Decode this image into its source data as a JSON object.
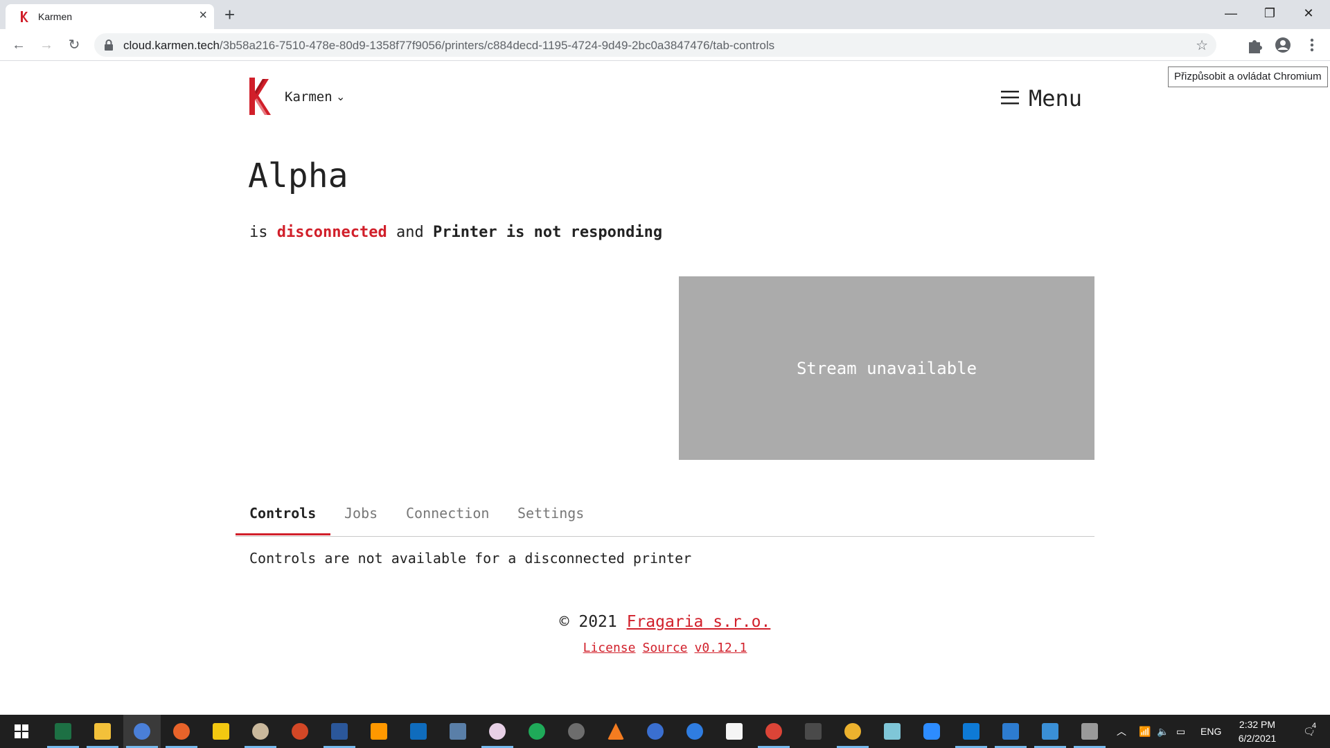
{
  "browser": {
    "tab_title": "Karmen",
    "url_host": "cloud.karmen.tech",
    "url_path": "/3b58a216-7510-478e-80d9-1358f77f9056/printers/c884decd-1195-4724-9d49-2bc0a3847476/tab-controls",
    "tooltip": "Přizpůsobit a ovládat Chromium"
  },
  "header": {
    "brand": "Karmen",
    "menu_label": "Menu"
  },
  "printer": {
    "name": "Alpha",
    "status_prefix": "is",
    "status_connection": "disconnected",
    "status_and": "and",
    "status_printer": "Printer is not responding"
  },
  "stream": {
    "message": "Stream unavailable"
  },
  "tabs": [
    {
      "label": "Controls",
      "active": true
    },
    {
      "label": "Jobs",
      "active": false
    },
    {
      "label": "Connection",
      "active": false
    },
    {
      "label": "Settings",
      "active": false
    }
  ],
  "tab_content": "Controls are not available for a disconnected printer",
  "footer": {
    "copyright": "© 2021",
    "company": "Fragaria s.r.o.",
    "links": [
      "License",
      "Source",
      "v0.12.1"
    ]
  },
  "taskbar": {
    "apps": [
      "start-icon",
      "excel-icon",
      "file-explorer-icon",
      "chromium-icon",
      "firefox-icon",
      "power-bi-icon",
      "paint-icon",
      "powerpoint-icon",
      "word-icon",
      "sublime-icon",
      "outlook-icon",
      "calculator-icon",
      "paint3d-icon",
      "app-green-icon",
      "app-ant-icon",
      "vlc-icon",
      "davinci-icon",
      "app-blue-icon",
      "notepad-icon",
      "chrome-r-icon",
      "clapper-icon",
      "slack-icon",
      "app-teal-icon",
      "zoom-icon",
      "vscode-icon",
      "photos-icon",
      "app-card-icon",
      "app-printer-icon"
    ],
    "language": "ENG",
    "time": "2:32 PM",
    "date": "6/2/2021",
    "notifications": "4"
  },
  "colors": {
    "accent": "#d11f2a",
    "stream_bg": "#ababab",
    "taskbar_bg": "#1f1f1f"
  }
}
